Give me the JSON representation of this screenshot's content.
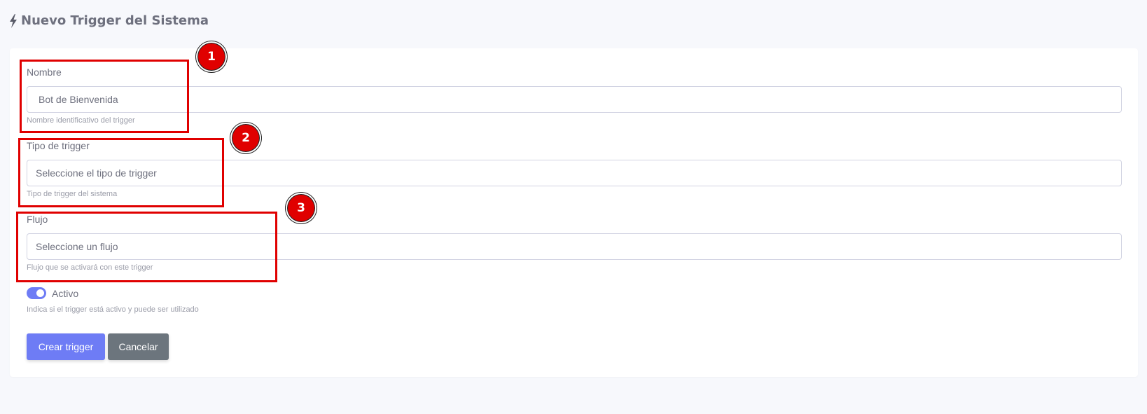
{
  "header": {
    "title": "Nuevo Trigger del Sistema",
    "icon": "bolt-icon"
  },
  "form": {
    "nombre": {
      "label": "Nombre",
      "value": "Bot de Bienvenida",
      "help": "Nombre identificativo del trigger"
    },
    "tipo": {
      "label": "Tipo de trigger",
      "value": "Seleccione el tipo de trigger",
      "help": "Tipo de trigger del sistema"
    },
    "flujo": {
      "label": "Flujo",
      "value": "Seleccione un flujo",
      "help": "Flujo que se activará con este trigger"
    },
    "activo": {
      "label": "Activo",
      "checked": true,
      "help": "Indica si el trigger está activo y puede ser utilizado"
    }
  },
  "buttons": {
    "create": "Crear trigger",
    "cancel": "Cancelar"
  },
  "annotations": [
    "1",
    "2",
    "3"
  ],
  "colors": {
    "accent": "#6e7cf5",
    "secondary": "#6c757d",
    "annotation": "#e00000"
  }
}
